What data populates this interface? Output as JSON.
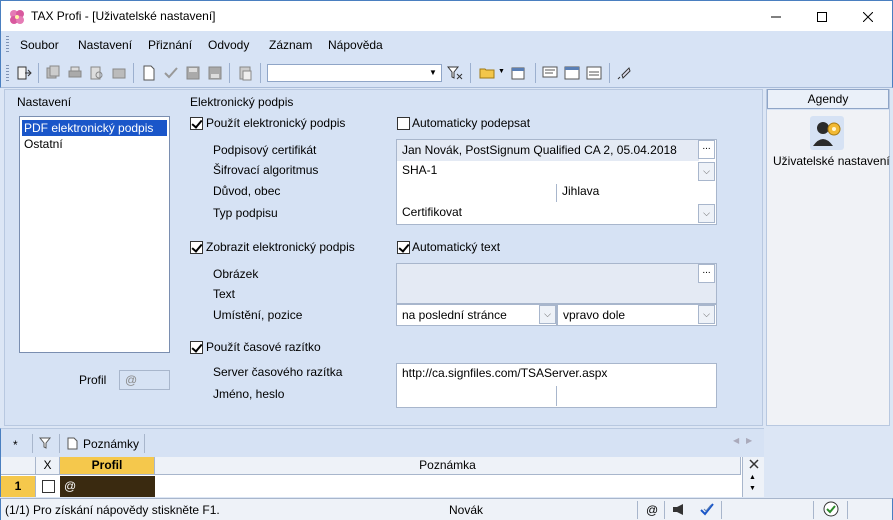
{
  "window": {
    "title": "TAX Profi - [Uživatelské nastavení]"
  },
  "menu": [
    "Soubor",
    "Nastavení",
    "Přiznání",
    "Odvody",
    "Záznam",
    "Nápověda"
  ],
  "left": {
    "heading": "Nastavení",
    "items": [
      "PDF elektronický podpis",
      "Ostatní"
    ],
    "profil_label": "Profil",
    "profil_value": "@"
  },
  "signature": {
    "heading": "Elektronický podpis",
    "use_signature": {
      "label": "Použít elektronický podpis",
      "checked": true
    },
    "auto_sign": {
      "label": "Automaticky podepsat",
      "checked": false
    },
    "certificate_label": "Podpisový certifikát",
    "certificate_value": "Jan Novák, PostSignum Qualified CA 2, 05.04.2018",
    "algorithm_label": "Šifrovací algoritmus",
    "algorithm_value": "SHA-1",
    "reason_label": "Důvod, obec",
    "reason_value": "",
    "city_value": "Jihlava",
    "type_label": "Typ podpisu",
    "type_value": "Certifikovat",
    "show_signature": {
      "label": "Zobrazit elektronický podpis",
      "checked": true
    },
    "auto_text": {
      "label": "Automatický text",
      "checked": true
    },
    "image_label": "Obrázek",
    "text_label": "Text",
    "placement_label": "Umístění, pozice",
    "placement_value": "na poslední stránce",
    "position_value": "vpravo dole",
    "timestamp": {
      "label": "Použít časové razítko",
      "checked": true
    },
    "ts_server_label": "Server časového razítka",
    "ts_server_value": "http://ca.signfiles.com/TSAServer.aspx",
    "ts_login_label": "Jméno, heslo"
  },
  "agendy": {
    "title": "Agendy",
    "item_label": "Uživatelské nastavení"
  },
  "notes": {
    "tab_star": "*",
    "tab_label": "Poznámky",
    "columns": [
      "X",
      "Profil",
      "Poznámka"
    ],
    "rows": [
      {
        "num": "1",
        "checked": false,
        "profil": "@",
        "note": ""
      }
    ]
  },
  "status": {
    "help": "(1/1)  Pro získání nápovědy stiskněte F1.",
    "user": "Novák",
    "at": "@"
  }
}
